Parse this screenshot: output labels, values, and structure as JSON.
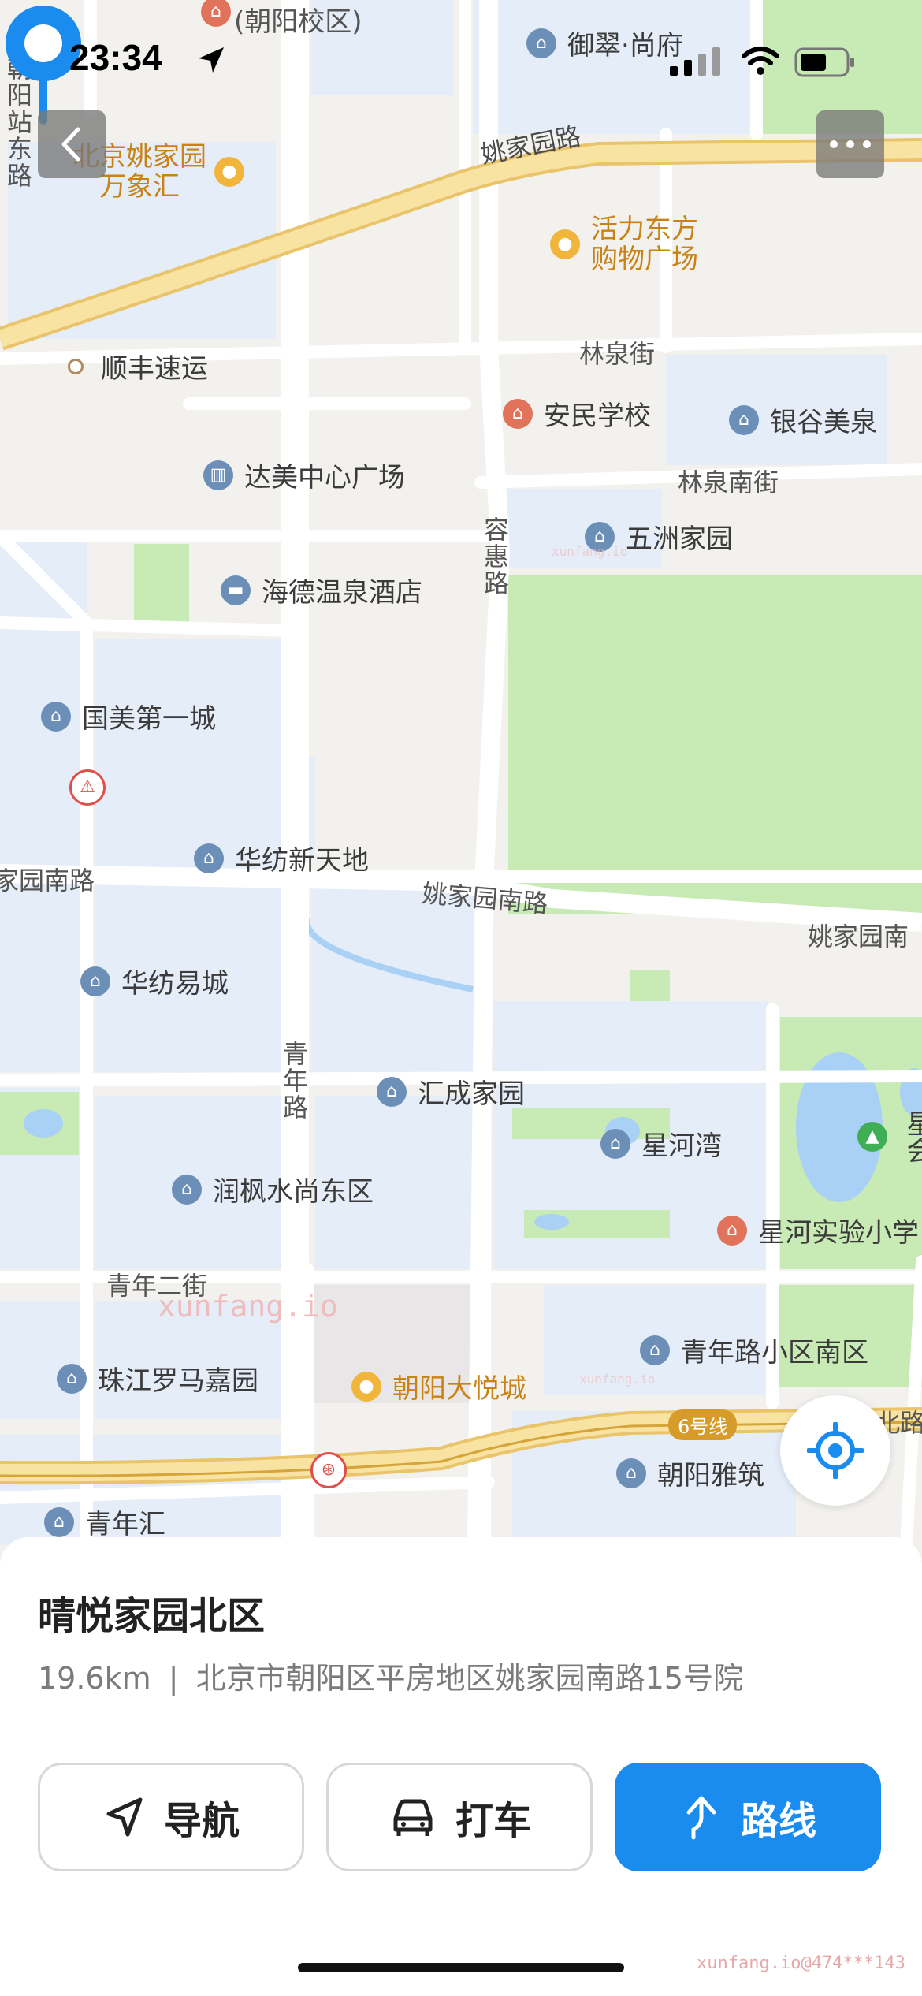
{
  "status_bar": {
    "time": "23:34"
  },
  "map": {
    "roads": [
      {
        "id": "yaojiayuan-road",
        "label": "姚家园路"
      },
      {
        "id": "linquan-st",
        "label": "林泉街"
      },
      {
        "id": "linquan-south-st",
        "label": "林泉南街"
      },
      {
        "id": "ronghui-rd",
        "label": "容惠路"
      },
      {
        "id": "yaojiayuan-south-rd",
        "label": "姚家园南路"
      },
      {
        "id": "yaojiayuan-south-rd-left",
        "label": "家园南路"
      },
      {
        "id": "yaojiayuan-south-rd-right",
        "label": "姚家园南"
      },
      {
        "id": "qingnian-rd",
        "label": "青年路"
      },
      {
        "id": "qingnian-2nd-st",
        "label": "青年二街"
      },
      {
        "id": "chaoyang-station-east-rd",
        "label": "朝阳站东路"
      },
      {
        "id": "line6",
        "label": "6号线"
      },
      {
        "id": "bei-road-frag",
        "label": "北路"
      }
    ],
    "pois": [
      {
        "id": "chaoyang-campus",
        "label": "(朝阳校区)"
      },
      {
        "id": "yucui-shangfu",
        "label": "御翠·尚府"
      },
      {
        "id": "bjyjy-wanxianghui-1",
        "label": "北京姚家园"
      },
      {
        "id": "bjyjy-wanxianghui-2",
        "label": "万象汇"
      },
      {
        "id": "huoli-dongfang-1",
        "label": "活力东方"
      },
      {
        "id": "huoli-dongfang-2",
        "label": "购物广场"
      },
      {
        "id": "shunfeng",
        "label": "顺丰速运"
      },
      {
        "id": "anmin-school",
        "label": "安民学校"
      },
      {
        "id": "yingu-meiquan",
        "label": "银谷美泉"
      },
      {
        "id": "damei-center",
        "label": "达美中心广场"
      },
      {
        "id": "wuzhou-jiayuan",
        "label": "五洲家园"
      },
      {
        "id": "haide-hotel",
        "label": "海德温泉酒店"
      },
      {
        "id": "guomei-diyicheng",
        "label": "国美第一城"
      },
      {
        "id": "huafang-xintiandi",
        "label": "华纺新天地"
      },
      {
        "id": "huafang-yicheng",
        "label": "华纺易城"
      },
      {
        "id": "huicheng-jiayuan",
        "label": "汇成家园"
      },
      {
        "id": "xinghe-wan",
        "label": "星河湾"
      },
      {
        "id": "xing-park",
        "label": "星会"
      },
      {
        "id": "runfeng",
        "label": "润枫水尚东区"
      },
      {
        "id": "xinghe-school",
        "label": "星河实验小学"
      },
      {
        "id": "qingnianlu-south",
        "label": "青年路小区南区"
      },
      {
        "id": "zhujiang-roma",
        "label": "珠江罗马嘉园"
      },
      {
        "id": "chaoyang-joycity",
        "label": "朝阳大悦城"
      },
      {
        "id": "chaoyang-yazhu",
        "label": "朝阳雅筑"
      },
      {
        "id": "qingnian-hui",
        "label": "青年汇"
      }
    ],
    "watermarks": [
      "xunfang.io",
      "xunfang.io",
      "xunfang.io"
    ]
  },
  "place": {
    "title": "晴悦家园北区",
    "distance": "19.6km",
    "separator": "|",
    "address": "北京市朝阳区平房地区姚家园南路15号院"
  },
  "actions": {
    "navigate_label": "导航",
    "taxi_label": "打车",
    "route_label": "路线"
  },
  "footer_watermark": "xunfang.io@474***143",
  "colors": {
    "accent": "#1a8cf0",
    "park": "#c8eab5",
    "residential": "#e4edf8",
    "arterial": "#f4d98a"
  }
}
